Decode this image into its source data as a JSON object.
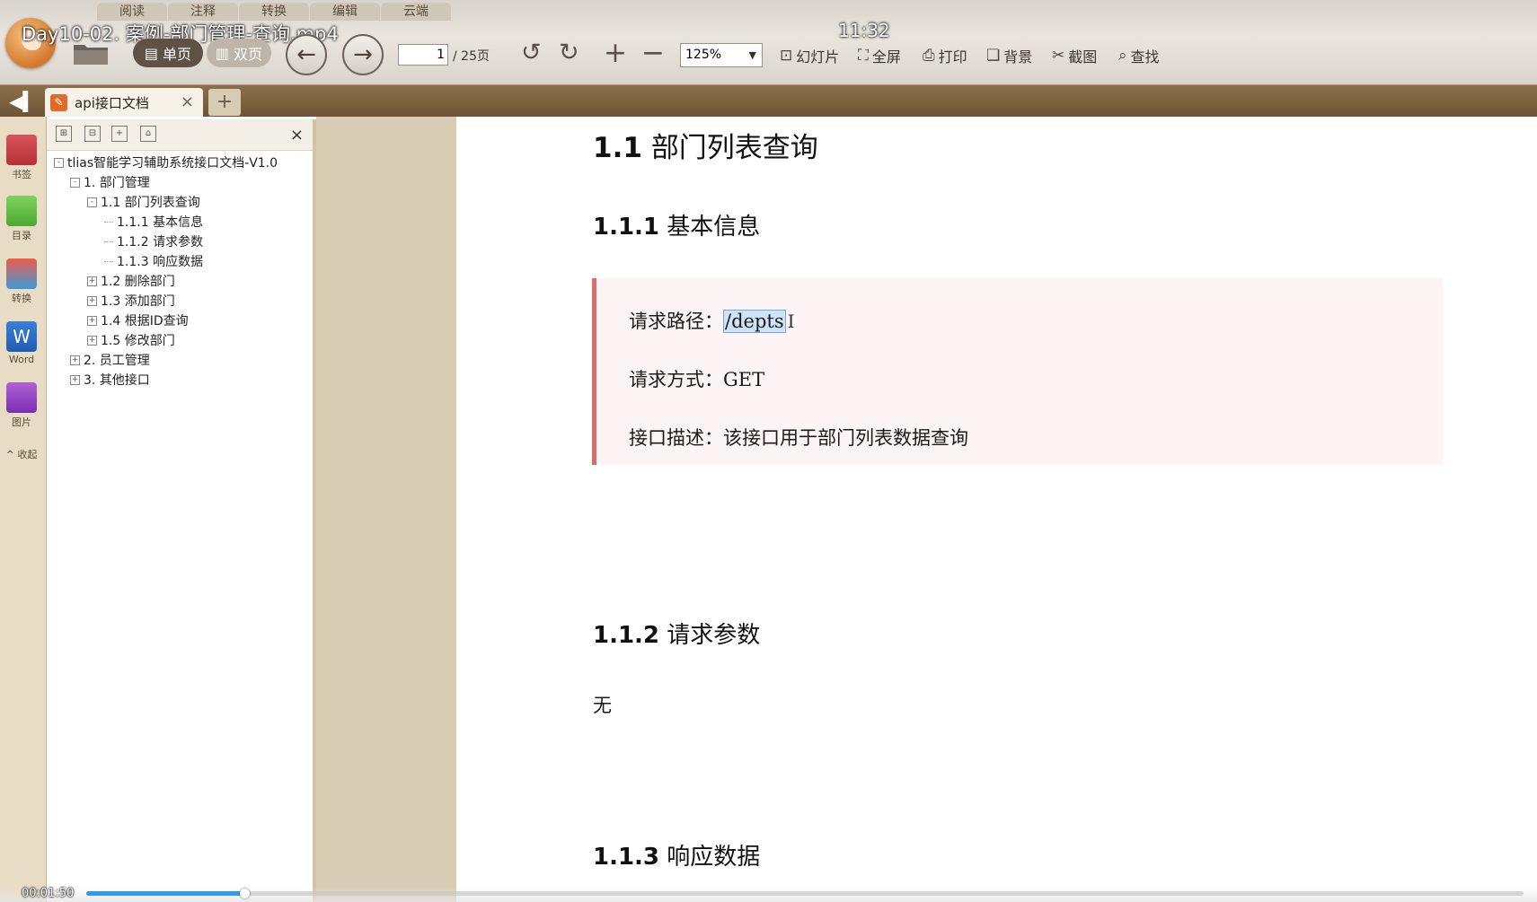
{
  "menu_tabs": [
    "阅读",
    "注释",
    "转换",
    "编辑",
    "云端"
  ],
  "video": {
    "title": "Day10-02. 案例-部门管理-查询.mp4",
    "clock": "11:32",
    "elapsed": "00:01:50",
    "progress_fraction": 0.11
  },
  "toolbar": {
    "single_page": "单页",
    "double_page": "双页",
    "page_current": "1",
    "page_total": "/ 25页",
    "zoom": "125%",
    "slideshow": "幻灯片",
    "fullscreen": "全屏",
    "print": "打印",
    "background": "背景",
    "screenshot": "截图",
    "find": "查找"
  },
  "tabs": {
    "active_label": "api接口文档",
    "close": "×",
    "new": "+"
  },
  "rail": {
    "bookmark": "书签",
    "toc": "目录",
    "convert": "转换",
    "word": "Word",
    "word_glyph": "W",
    "image": "图片",
    "collapse": "^ 收起"
  },
  "toc": {
    "close": "×",
    "items": [
      {
        "label": "tlias智能学习辅助系统接口文档-V1.0",
        "box": "-"
      },
      {
        "label": "1. 部门管理",
        "box": "-"
      },
      {
        "label": "1.1 部门列表查询",
        "box": "-"
      },
      {
        "label": "1.1.1 基本信息",
        "box": ""
      },
      {
        "label": "1.1.2 请求参数",
        "box": ""
      },
      {
        "label": "1.1.3 响应数据",
        "box": ""
      },
      {
        "label": "1.2 删除部门",
        "box": "+"
      },
      {
        "label": "1.3 添加部门",
        "box": "+"
      },
      {
        "label": "1.4 根据ID查询",
        "box": "+"
      },
      {
        "label": "1.5 修改部门",
        "box": "+"
      },
      {
        "label": "2. 员工管理",
        "box": "+"
      },
      {
        "label": "3. 其他接口",
        "box": "+"
      }
    ]
  },
  "document": {
    "h_11_num": "1.1",
    "h_11_text": " 部门列表查询",
    "h_111_num": "1.1.1",
    "h_111_text": " 基本信息",
    "path_label": "请求路径：",
    "path_value": "/depts",
    "method_label": "请求方式：",
    "method_value": "GET",
    "desc_label": "接口描述：",
    "desc_value": "该接口用于部门列表数据查询",
    "h_112_num": "1.1.2",
    "h_112_text": " 请求参数",
    "params_none": "无",
    "h_113_num": "1.1.3",
    "h_113_text": " 响应数据"
  }
}
